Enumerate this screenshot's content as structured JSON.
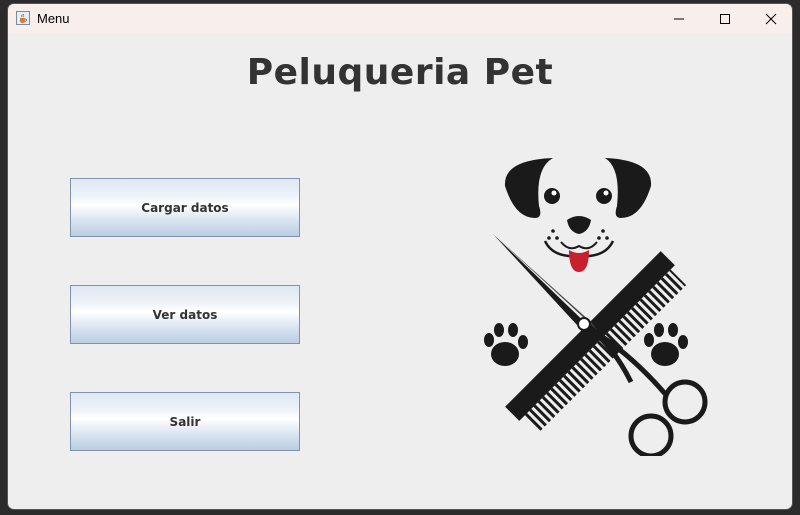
{
  "window": {
    "title": "Menu"
  },
  "main": {
    "heading": "Peluqueria Pet",
    "buttons": [
      {
        "label": "Cargar datos"
      },
      {
        "label": "Ver datos"
      },
      {
        "label": "Salir"
      }
    ]
  },
  "icons": {
    "app": "java-cup-icon",
    "minimize": "minimize-icon",
    "maximize": "maximize-icon",
    "close": "close-icon",
    "logo": "dog-grooming-logo"
  },
  "colors": {
    "heading": "#333333",
    "tongue": "#c8202c",
    "logo_dark": "#1a1a1a",
    "button_border": "#7f93ad"
  }
}
